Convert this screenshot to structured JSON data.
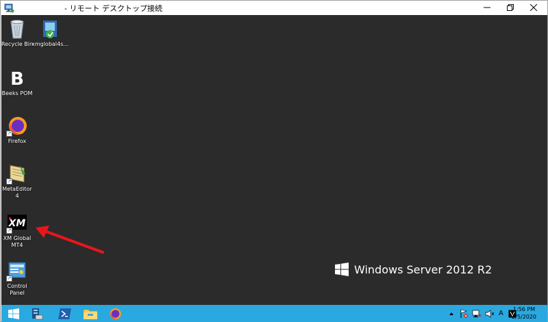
{
  "window": {
    "title": "- リモート デスクトップ接続"
  },
  "desktop": {
    "icons": [
      {
        "label": "Recycle Bin",
        "icon": "recycle-bin-icon"
      },
      {
        "label": "xmglobal4s...",
        "icon": "installer-icon"
      },
      {
        "label": "Beeks POM",
        "icon": "beeks-pom-icon"
      },
      {
        "label": "Firefox",
        "icon": "firefox-icon"
      },
      {
        "label": "MetaEditor 4",
        "icon": "metaeditor-icon"
      },
      {
        "label": "XM Global MT4",
        "icon": "xm-mt4-icon"
      },
      {
        "label": "Control Panel",
        "icon": "control-panel-icon"
      }
    ],
    "branding": "Windows Server 2012 R2",
    "annotation_color": "#e8161b"
  },
  "taskbar": {
    "buttons": [
      "start-icon",
      "server-manager-icon",
      "powershell-icon",
      "file-explorer-icon",
      "firefox-icon"
    ],
    "tray": {
      "ime": "A"
    },
    "clock": {
      "time": "1:56 PM",
      "date": "2/5/2020"
    },
    "color": "#2aa9e0"
  },
  "colors": {
    "desktop_bg": "#2b2b2b"
  }
}
